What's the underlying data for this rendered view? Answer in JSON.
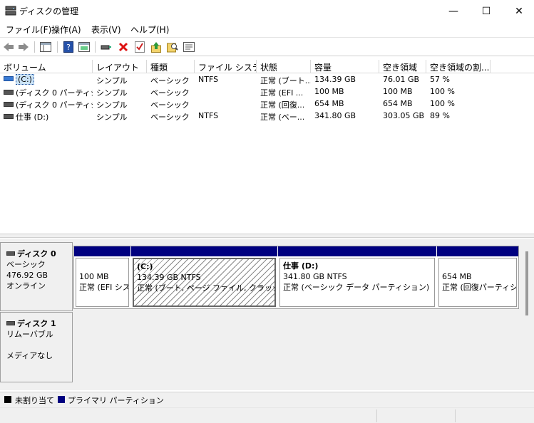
{
  "window": {
    "title": "ディスクの管理",
    "minimize": "—",
    "maximize": "☐",
    "close": "✕"
  },
  "menu": [
    "ファイル(F)",
    "操作(A)",
    "表示(V)",
    "ヘルプ(H)"
  ],
  "toolbar": [
    "back-icon",
    "forward-icon",
    "properties-pane-icon",
    "help-icon",
    "console-tree-icon",
    "connect-icon",
    "delete-icon",
    "checklist-icon",
    "up-arrow-icon",
    "search-folder-icon",
    "settings-list-icon"
  ],
  "columns": [
    "ボリューム",
    "レイアウト",
    "種類",
    "ファイル システム",
    "状態",
    "容量",
    "空き領域",
    "空き領域の割..."
  ],
  "volumes": [
    {
      "name": "(C:)",
      "layout": "シンプル",
      "type": "ベーシック",
      "fs": "NTFS",
      "status": "正常 (ブート...",
      "capacity": "134.39 GB",
      "free": "76.01 GB",
      "pct": "57 %"
    },
    {
      "name": "(ディスク 0 パーティシ...",
      "layout": "シンプル",
      "type": "ベーシック",
      "fs": "",
      "status": "正常 (EFI ...",
      "capacity": "100 MB",
      "free": "100 MB",
      "pct": "100 %"
    },
    {
      "name": "(ディスク 0 パーティシ...",
      "layout": "シンプル",
      "type": "ベーシック",
      "fs": "",
      "status": "正常 (回復...",
      "capacity": "654 MB",
      "free": "654 MB",
      "pct": "100 %"
    },
    {
      "name": "仕事 (D:)",
      "layout": "シンプル",
      "type": "ベーシック",
      "fs": "NTFS",
      "status": "正常 (ベー...",
      "capacity": "341.80 GB",
      "free": "303.05 GB",
      "pct": "89 %"
    }
  ],
  "disk0": {
    "name": "ディスク 0",
    "kind": "ベーシック",
    "size": "476.92 GB",
    "state": "オンライン",
    "partitions": [
      {
        "title": "",
        "size": "100 MB",
        "status": "正常 (EFI シス"
      },
      {
        "title": "(C:)",
        "size": "134.39 GB NTFS",
        "status": "正常 (ブート, ページ ファイル, クラッシュ ダン"
      },
      {
        "title": "仕事  (D:)",
        "size": "341.80 GB NTFS",
        "status": "正常 (ベーシック データ パーティション)"
      },
      {
        "title": "",
        "size": "654 MB",
        "status": "正常 (回復パーティシ"
      }
    ]
  },
  "disk1": {
    "name": "ディスク 1",
    "kind": "リムーバブル",
    "media": "メディアなし"
  },
  "legend": [
    {
      "label": "未割り当て",
      "color": "#000000"
    },
    {
      "label": "プライマリ パーティション",
      "color": "#000080"
    }
  ]
}
